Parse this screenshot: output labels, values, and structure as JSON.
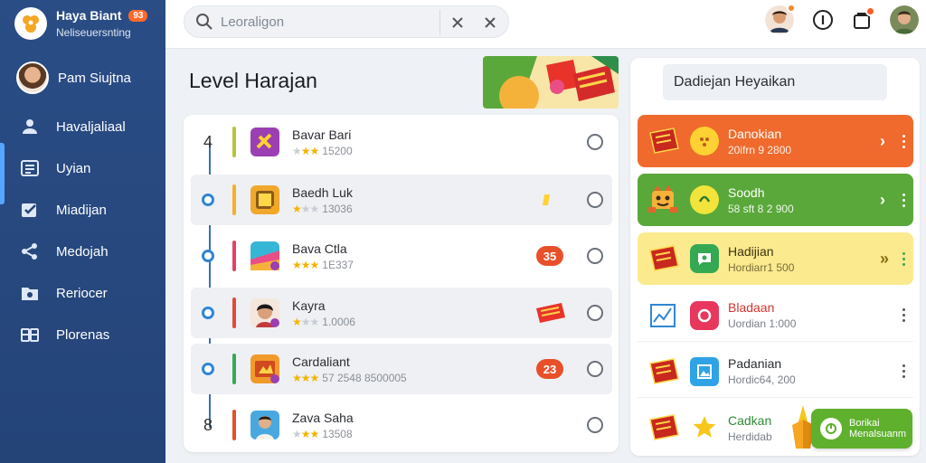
{
  "app": {
    "title": "Haya Biant",
    "badge": "93",
    "subtitle": "Neliseuersnting"
  },
  "profile": {
    "name": "Pam Siujtna"
  },
  "sidebar": {
    "items": [
      {
        "label": "Havaljaliaal",
        "icon": "user-icon"
      },
      {
        "label": "Uyian",
        "icon": "list-icon"
      },
      {
        "label": "Miadijan",
        "icon": "check-icon"
      },
      {
        "label": "Medojah",
        "icon": "share-icon"
      },
      {
        "label": "Reriocer",
        "icon": "folder-icon"
      },
      {
        "label": "Plorenas",
        "icon": "grid-icon"
      }
    ]
  },
  "search": {
    "placeholder": "Leoraligon"
  },
  "main": {
    "title": "Level Harajan",
    "levels": [
      {
        "num": "4",
        "name": "Bavar Bari",
        "stars": 3,
        "meta": "15200",
        "bar_color": "#b8c43a",
        "thumb": "#9b3fb3",
        "badge": "",
        "shaded": false
      },
      {
        "num": "",
        "name": "Baedh Luk",
        "stars": 1,
        "meta": "13036",
        "bar_color": "#f3b12b",
        "thumb": "#f1a82c",
        "badge": "",
        "shaded": true
      },
      {
        "num": "",
        "name": "Bava Ctla",
        "stars": 3,
        "meta": "1E337",
        "bar_color": "#e4406a",
        "thumb": "#36b6d6",
        "badge": "35",
        "shaded": false
      },
      {
        "num": "",
        "name": "Kayra",
        "stars": 1,
        "meta": "1.0006",
        "bar_color": "#e34a3a",
        "thumb": "#f4d9c2",
        "badge": "",
        "shaded": true
      },
      {
        "num": "",
        "name": "Cardaliant",
        "stars": 3,
        "meta": "57 2548 8500005",
        "bar_color": "#3aa853",
        "thumb": "#f09a2a",
        "badge": "23",
        "shaded": true
      },
      {
        "num": "8",
        "name": "Zava Saha",
        "stars": 3,
        "meta": "13508",
        "bar_color": "#e4502a",
        "thumb": "#4aa8e0",
        "badge": "",
        "shaded": false
      }
    ]
  },
  "right": {
    "header": "Dadiejan Heyaikan",
    "items": [
      {
        "name": "Danokian",
        "sub": "20ifrn 9 2800",
        "style": "orange",
        "icon_bg": "#ffd233",
        "chevron": true
      },
      {
        "name": "Soodh",
        "sub": "58 sft 8 2 900",
        "style": "green",
        "icon_bg": "#f2e43a",
        "chevron": true
      },
      {
        "name": "Hadijian",
        "sub": "Hordiarr1 500",
        "style": "yellow",
        "icon_bg": "#34a853",
        "chevron": true
      },
      {
        "name": "Bladaan",
        "sub": "Uordian 1:000",
        "style": "plain",
        "icon_bg": "#e8365d",
        "chevron": false
      },
      {
        "name": "Padanian",
        "sub": "Hordic64, 200",
        "style": "plain",
        "icon_bg": "#2fa3e6",
        "chevron": false
      },
      {
        "name": "Cadkan",
        "sub": "Herdidab",
        "style": "plain",
        "icon_bg": "#f7c61a",
        "chevron": false
      }
    ],
    "action_button": {
      "line1": "Borikai",
      "line2": "Menalsuanm"
    }
  },
  "colors": {
    "sidebar": "#2a4d86",
    "accent": "#2f86d6",
    "badge": "#e8502a"
  }
}
